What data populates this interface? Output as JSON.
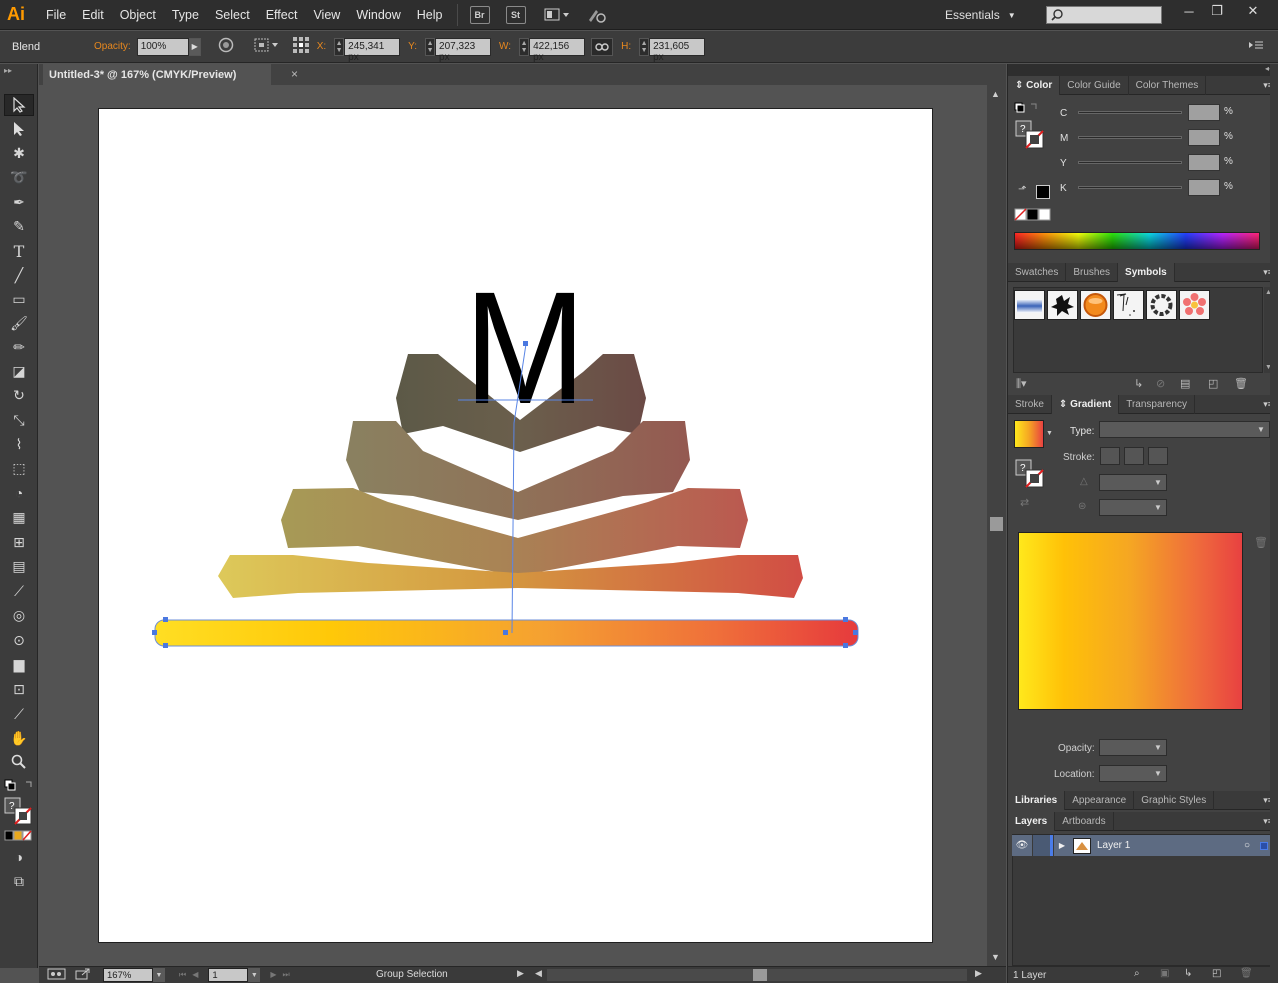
{
  "app": {
    "logo": "Ai",
    "menus": [
      "File",
      "Edit",
      "Object",
      "Type",
      "Select",
      "Effect",
      "View",
      "Window",
      "Help"
    ],
    "bridge_label": "Br",
    "stock_label": "St",
    "workspace": "Essentials",
    "window_buttons": [
      "─",
      "❐",
      "✕"
    ]
  },
  "control": {
    "selection_label": "Blend",
    "opacity_label": "Opacity:",
    "opacity_value": "100%",
    "x_label": "X:",
    "x_value": "245,341 px",
    "y_label": "Y:",
    "y_value": "207,323 px",
    "w_label": "W:",
    "w_value": "422,156 px",
    "h_label": "H:",
    "h_value": "231,605 px"
  },
  "document": {
    "tab_title": "Untitled-3* @ 167% (CMYK/Preview)",
    "close": "×",
    "art_letter": "M"
  },
  "status": {
    "zoom": "167%",
    "artboard_number": "1",
    "tool_status": "Group Selection"
  },
  "color_panel": {
    "tabs": [
      "Color",
      "Color Guide",
      "Color Themes"
    ],
    "channels": [
      {
        "label": "C",
        "pct": "%"
      },
      {
        "label": "M",
        "pct": "%"
      },
      {
        "label": "Y",
        "pct": "%"
      },
      {
        "label": "K",
        "pct": "%"
      }
    ]
  },
  "symbols_panel": {
    "tabs": [
      "Swatches",
      "Brushes",
      "Symbols"
    ]
  },
  "gradient_panel": {
    "tabs": [
      "Stroke",
      "Gradient",
      "Transparency"
    ],
    "type_label": "Type:",
    "stroke_label": "Stroke:",
    "opacity_label": "Opacity:",
    "location_label": "Location:",
    "colors": [
      "#ffe81c",
      "#ffc107",
      "#f5a623",
      "#ef6b3c",
      "#e84141"
    ]
  },
  "libraries_panel": {
    "tabs": [
      "Libraries",
      "Appearance",
      "Graphic Styles"
    ]
  },
  "layers_panel": {
    "tabs": [
      "Layers",
      "Artboards"
    ],
    "layers": [
      {
        "name": "Layer 1"
      }
    ],
    "count_label": "1 Layer"
  }
}
